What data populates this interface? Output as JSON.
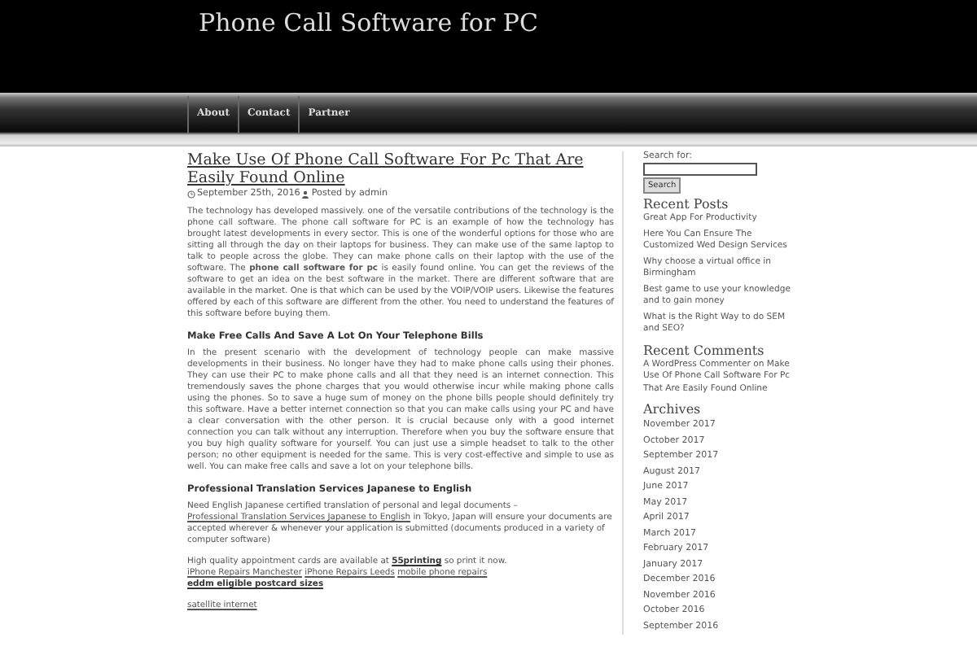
{
  "site_title": "Phone Call Software for PC",
  "nav": [
    {
      "label": "About"
    },
    {
      "label": "Contact"
    },
    {
      "label": "Partner"
    }
  ],
  "post": {
    "title": "Make Use Of Phone Call Software For Pc That Are Easily Found Online",
    "date": "September 25th, 2016",
    "author": "Posted by admin",
    "blocks": [
      {
        "kind": "para",
        "text": "The technology has developed massively. one of the versatile contributions of the technology is the phone call software. The phone call software for PC is an example of how the technology has brought latest developments in every sector. This is one of the wonderful options for those who are sitting all through the day on their laptops for business. They can make use of the same laptop to talk to people across the globe. They can make phone calls on their laptop with the use of the software. The **phone call software for pc** is easily found online. You can get the reviews of the software to get an idea on the best software in the market. There are different software that are available in the market. One is that which can be used by the VOIP/VOIP users. Likewise the features offered by each of this software are different from the other. You need to understand the features of this software before buying them."
      },
      {
        "kind": "heading",
        "text": "Make Free Calls And Save A Lot On Your Telephone Bills"
      },
      {
        "kind": "para",
        "text": "In the present scenario with the development of technology people can make massive developments in their business. No longer have they had to make phone calls using their phones. They can use their PC to make phone calls and all that they need is an internet connection. This tremendously saves the phone charges that you would otherwise incur while making phone calls using the phones. So to save a huge sum of money on the phone bills people should definitely try this software. Have a better internet connection so that you can make calls using your PC and have a clear conversation with the other person. It is crucial because only with a good internet connection you can talk without any interruption. Therefore when you buy the software ensure that you buy high quality software for yourself. You can just use a simple headset to talk to the other person; no other equipment is needed for the same.  This is very cost-effective and simple to use as well. You can make free calls and save a lot on your telephone bills."
      },
      {
        "kind": "heading",
        "text": "Professional Translation Services Japanese to English"
      },
      {
        "kind": "note",
        "segments": [
          {
            "kind": "text",
            "text": "Need English Japanese certified translation of personal and legal documents –"
          },
          {
            "kind": "link",
            "text": "Professional Translation Services Japanese to English"
          },
          {
            "kind": "text",
            "text": "in Tokyo, Japan will ensure your documents are accepted wherever & whenever your application is submitted (documents produced in a variety of computer software)"
          }
        ]
      },
      {
        "kind": "note",
        "segments": [
          {
            "kind": "text",
            "text": "High quality appointment cards are available at"
          },
          {
            "kind": "boldlink",
            "text": "55printing"
          },
          {
            "kind": "text",
            "text": "so print it now."
          },
          {
            "kind": "link",
            "text": "iPhone Repairs Manchester"
          },
          {
            "kind": "link",
            "text": "iPhone Repairs Leeds"
          },
          {
            "kind": "link",
            "text": "mobile phone repairs"
          },
          {
            "kind": "break"
          },
          {
            "kind": "boldlink",
            "text": "eddm eligible postcard sizes"
          }
        ]
      },
      {
        "kind": "note",
        "segments": [
          {
            "kind": "link",
            "text": "satellite internet"
          }
        ]
      }
    ]
  },
  "sidebar": {
    "search_label": "Search for:",
    "search_button": "Search",
    "recent_posts_title": "Recent Posts",
    "recent_posts": [
      "Great App For Productivity",
      "Here You Can Ensure The Customized Wed Design Services",
      "Why choose a virtual office in Birmingham",
      "Best game to use your knowledge and to gain money",
      "What is the Right Way to do SEM and SEO?"
    ],
    "recent_comments_title": "Recent Comments",
    "recent_comments": [
      {
        "author": "A WordPress Commenter",
        "on": "on",
        "post": "Make Use Of Phone Call Software For Pc That Are Easily Found Online"
      }
    ],
    "archives_title": "Archives",
    "archives": [
      "November 2017",
      "October 2017",
      "September 2017",
      "August 2017",
      "June 2017",
      "May 2017",
      "April 2017",
      "March 2017",
      "February 2017",
      "January 2017",
      "December 2016",
      "November 2016",
      "October 2016",
      "September 2016"
    ]
  }
}
